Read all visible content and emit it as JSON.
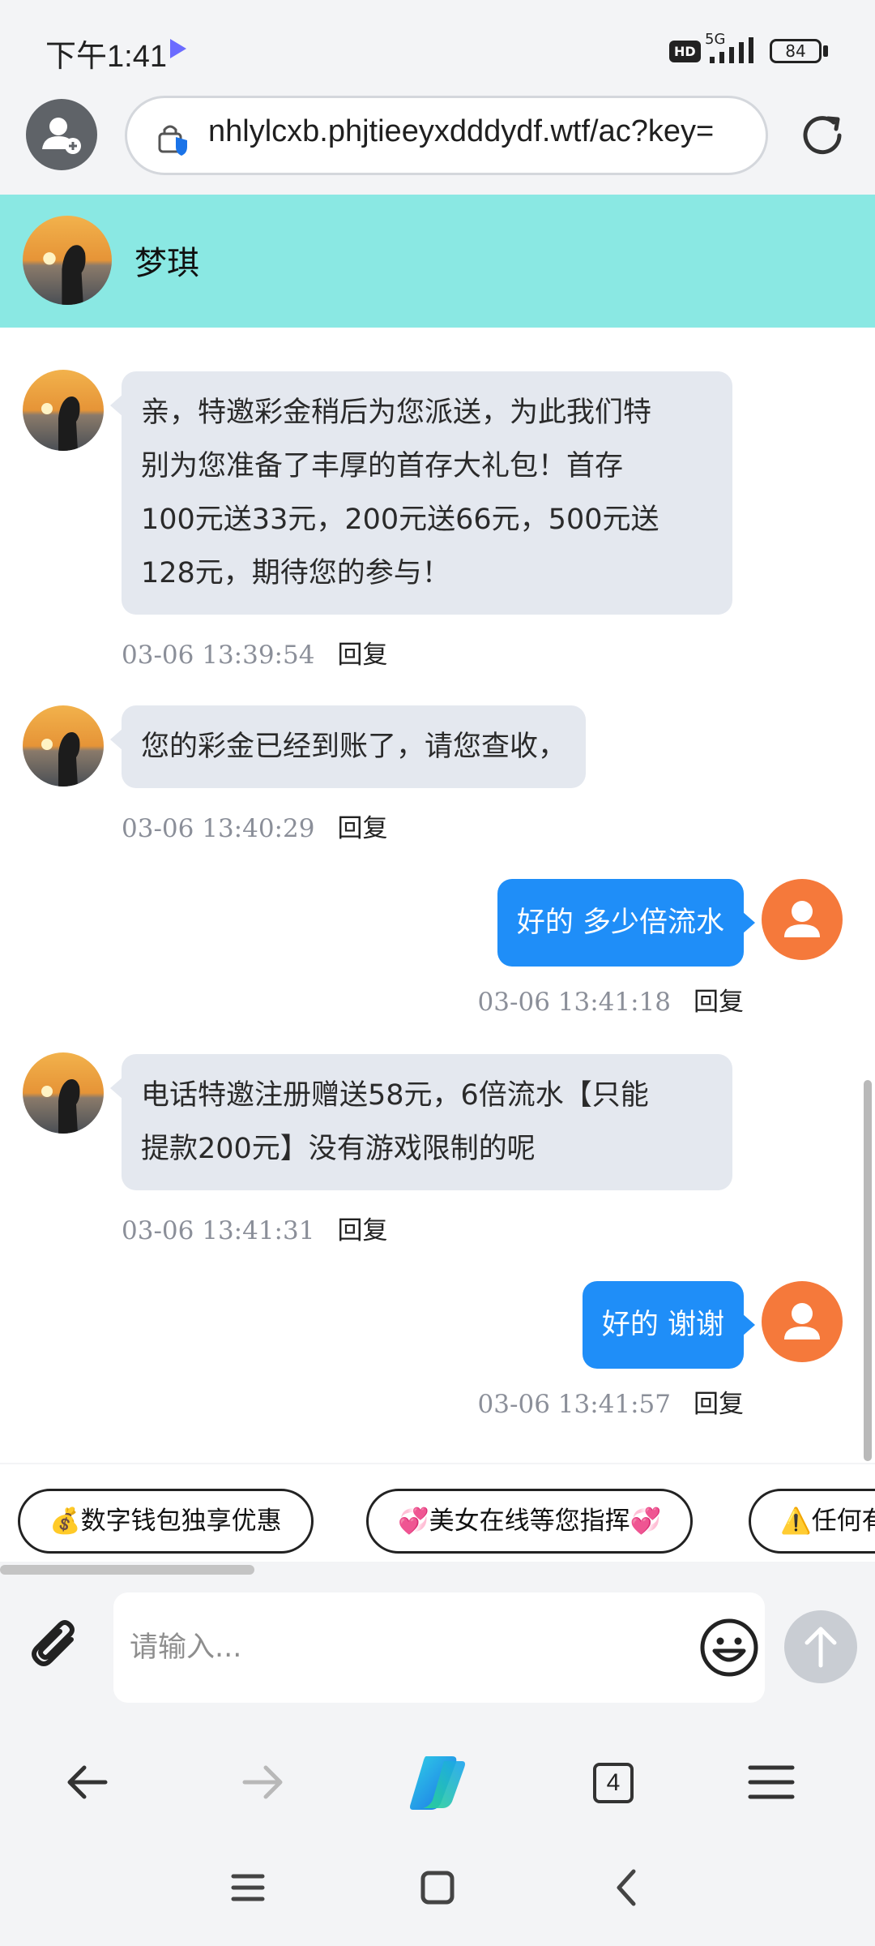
{
  "status_bar": {
    "time": "下午1:41",
    "hd_badge": "HD",
    "network": "5G",
    "battery": "84"
  },
  "browser": {
    "url": "nhlylcxb.phjtieeyxdddydf.wtf/ac?key=",
    "tab_count": "4"
  },
  "chat": {
    "contact_name": "梦琪",
    "reply_label": "回复",
    "messages": [
      {
        "direction": "in",
        "text": "亲，特邀彩金稍后为您派送，为此我们特别为您准备了丰厚的首存大礼包！首存100元送33元，200元送66元，500元送128元，期待您的参与！",
        "lines": [
          "亲，特邀彩金稍后为您派送，为此我们特",
          "别为您准备了丰厚的首存大礼包！首存",
          "100元送33元，200元送66元，500元送",
          "128元，期待您的参与！"
        ],
        "time": "03-06 13:39:54"
      },
      {
        "direction": "in",
        "text": "您的彩金已经到账了，请您查收，",
        "lines": [
          "您的彩金已经到账了，请您查收，"
        ],
        "time": "03-06 13:40:29"
      },
      {
        "direction": "out",
        "text": "好的 多少倍流水",
        "time": "03-06 13:41:18"
      },
      {
        "direction": "in",
        "text": "电话特邀注册赠送58元，6倍流水【只能提款200元】没有游戏限制的呢",
        "lines": [
          "电话特邀注册赠送58元，6倍流水【只能",
          "提款200元】没有游戏限制的呢"
        ],
        "time": "03-06 13:41:31"
      },
      {
        "direction": "out",
        "text": "好的 谢谢",
        "time": "03-06 13:41:57"
      }
    ]
  },
  "quick_replies": [
    "💰数字钱包独享优惠",
    "💞美女在线等您指挥💞",
    "⚠️任何有"
  ],
  "input": {
    "placeholder": "请输入..."
  },
  "colors": {
    "header_bg": "#8ae8e3",
    "outgoing_bubble": "#1f8ef8",
    "incoming_bubble": "#e4e8ef",
    "user_avatar": "#f5793b",
    "send_button_disabled": "#c9cdd3"
  },
  "icons": {
    "profile": "add-profile-icon",
    "lock": "security-lock-icon",
    "reload": "reload-icon",
    "attach": "paperclip-icon",
    "emoji": "smiley-icon",
    "send": "arrow-up-icon",
    "back": "arrow-left-icon",
    "forward": "arrow-right-icon",
    "copilot": "copilot-logo-icon",
    "menu": "hamburger-icon"
  }
}
